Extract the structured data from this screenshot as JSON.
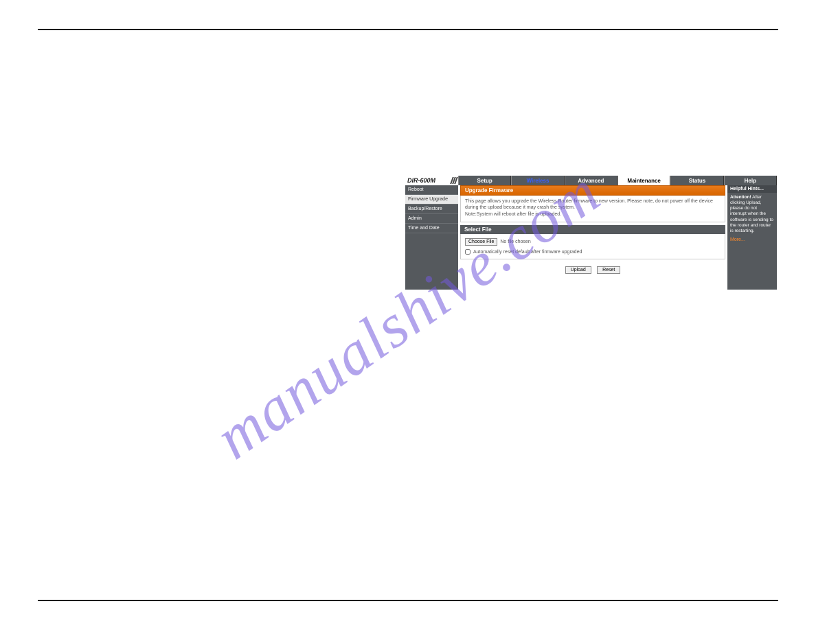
{
  "watermark": "manualshive.com",
  "model": "DIR-600M",
  "nav": {
    "setup": "Setup",
    "wireless": "Wireless",
    "advanced": "Advanced",
    "maintenance": "Maintenance",
    "status": "Status",
    "help": "Help"
  },
  "sidebar": {
    "reboot": "Reboot",
    "firmware_upgrade": "Firmware Upgrade",
    "backup_restore": "Backup/Restore",
    "admin": "Admin",
    "time_date": "Time and Date"
  },
  "main": {
    "upgrade_header": "Upgrade Firmware",
    "desc_line1": "This page allows you upgrade the Wireless Router firmware to new version. Please note, do not power off the device during the upload because it may crash the system.",
    "desc_line2": "Note:System will reboot after file is uploaded.",
    "select_header": "Select File",
    "choose_btn": "Choose File",
    "no_file": "No file chosen",
    "auto_reset": "Automatically reset default after firmware upgraded",
    "upload_btn": "Upload",
    "reset_btn": "Reset"
  },
  "hints": {
    "header": "Helpful Hints...",
    "attention_label": "Attention!",
    "attention_body": "After clicking Upload, please do not interrupt when the software is sending to the router and router is restarting.",
    "more": "More..."
  }
}
